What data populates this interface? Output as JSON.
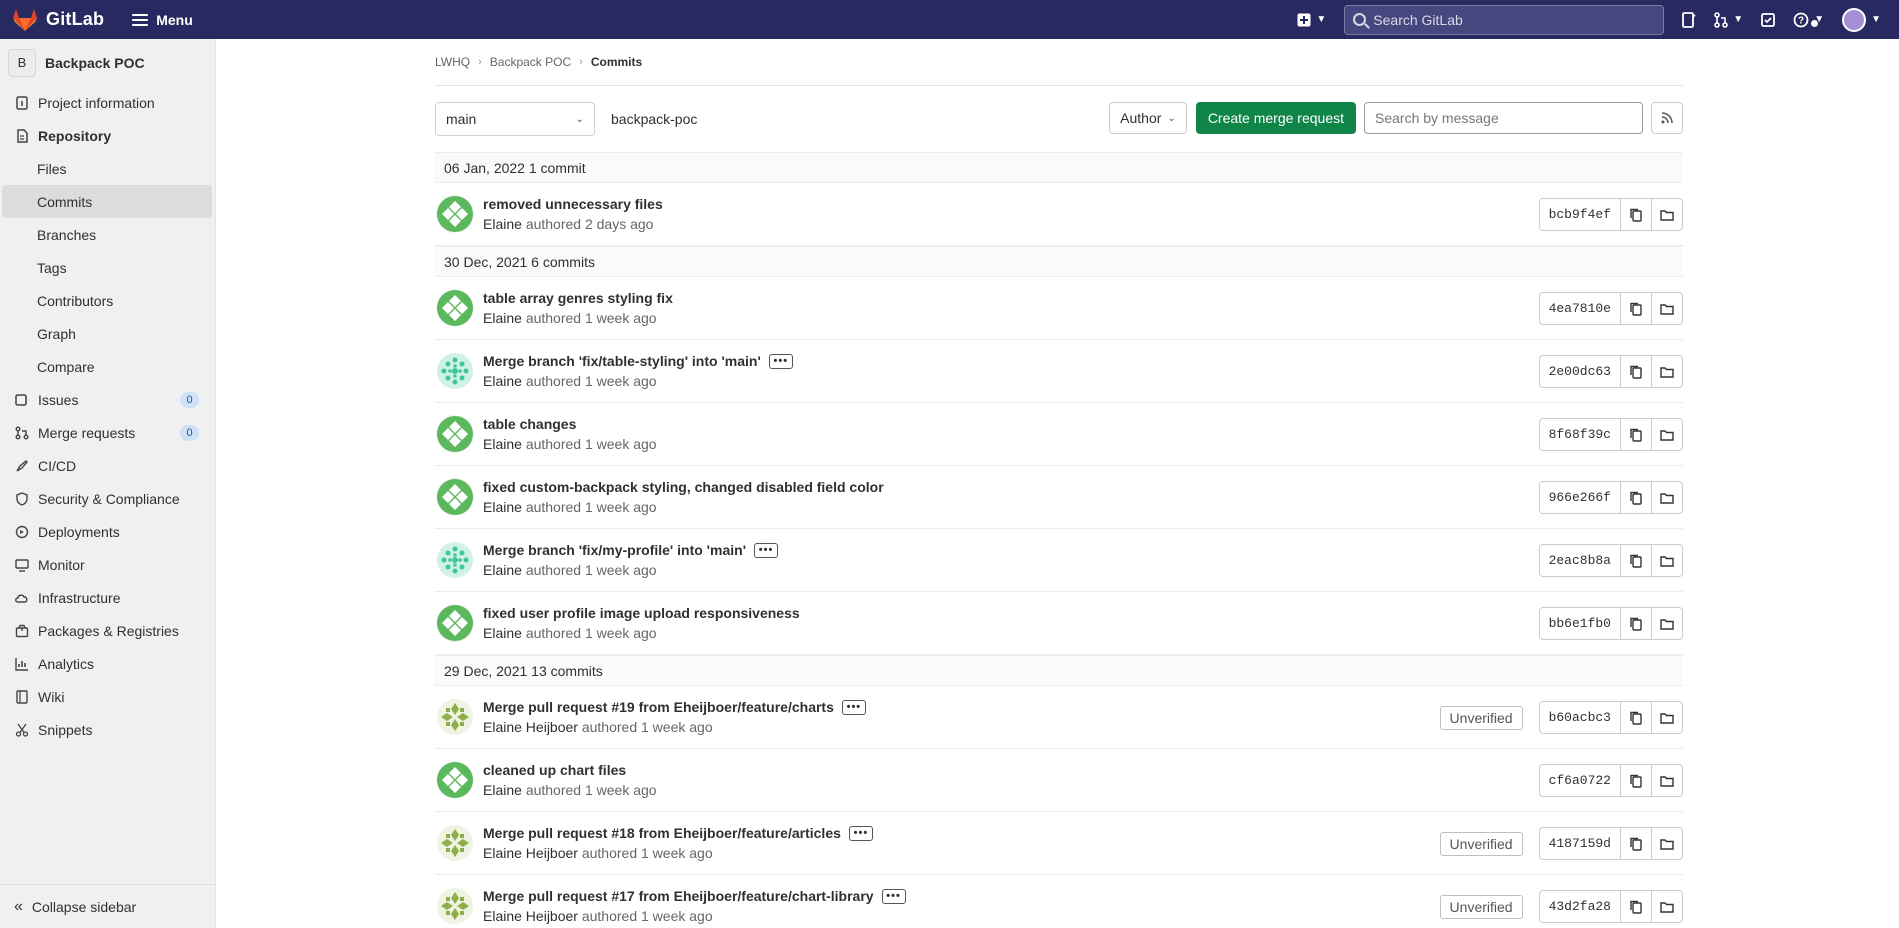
{
  "topbar": {
    "logo_text": "GitLab",
    "menu_label": "Menu",
    "search_placeholder": "Search GitLab",
    "brand_color": "#292961"
  },
  "sidebar": {
    "project_initial": "B",
    "project_name": "Backpack POC",
    "items": [
      {
        "label": "Project information",
        "icon": "info-icon"
      },
      {
        "label": "Repository",
        "icon": "repository-icon"
      },
      {
        "label": "Files"
      },
      {
        "label": "Commits"
      },
      {
        "label": "Branches"
      },
      {
        "label": "Tags"
      },
      {
        "label": "Contributors"
      },
      {
        "label": "Graph"
      },
      {
        "label": "Compare"
      },
      {
        "label": "Issues",
        "icon": "issues-icon",
        "count": "0"
      },
      {
        "label": "Merge requests",
        "icon": "merge-request-icon",
        "count": "0"
      },
      {
        "label": "CI/CD",
        "icon": "rocket-icon"
      },
      {
        "label": "Security & Compliance",
        "icon": "shield-icon"
      },
      {
        "label": "Deployments",
        "icon": "deployments-icon"
      },
      {
        "label": "Monitor",
        "icon": "monitor-icon"
      },
      {
        "label": "Infrastructure",
        "icon": "cloud-icon"
      },
      {
        "label": "Packages & Registries",
        "icon": "package-icon"
      },
      {
        "label": "Analytics",
        "icon": "chart-icon"
      },
      {
        "label": "Wiki",
        "icon": "book-icon"
      },
      {
        "label": "Snippets",
        "icon": "scissors-icon"
      }
    ],
    "collapse_label": "Collapse sidebar"
  },
  "breadcrumb": {
    "group": "LWHQ",
    "project": "Backpack POC",
    "current": "Commits"
  },
  "toolbar": {
    "branch": "main",
    "repo_path": "backpack-poc",
    "author_label": "Author",
    "create_mr_label": "Create merge request",
    "search_placeholder": "Search by message"
  },
  "days": [
    {
      "header": "06 Jan, 2022 1 commit",
      "commits": [
        {
          "title": "removed unnecessary files",
          "author": "Elaine",
          "when": "authored 2 days ago",
          "sha": "bcb9f4ef",
          "more": false,
          "unverified": "",
          "avatar": "green"
        }
      ]
    },
    {
      "header": "30 Dec, 2021 6 commits",
      "commits": [
        {
          "title": "table array genres styling fix",
          "author": "Elaine",
          "when": "authored 1 week ago",
          "sha": "4ea7810e",
          "more": false,
          "unverified": "",
          "avatar": "green"
        },
        {
          "title": "Merge branch 'fix/table-styling' into 'main'",
          "author": "Elaine",
          "when": "authored 1 week ago",
          "sha": "2e00dc63",
          "more": true,
          "unverified": "",
          "avatar": "teal"
        },
        {
          "title": "table changes",
          "author": "Elaine",
          "when": "authored 1 week ago",
          "sha": "8f68f39c",
          "more": false,
          "unverified": "",
          "avatar": "green"
        },
        {
          "title": "fixed custom-backpack styling, changed disabled field color",
          "author": "Elaine",
          "when": "authored 1 week ago",
          "sha": "966e266f",
          "more": false,
          "unverified": "",
          "avatar": "green"
        },
        {
          "title": "Merge branch 'fix/my-profile' into 'main'",
          "author": "Elaine",
          "when": "authored 1 week ago",
          "sha": "2eac8b8a",
          "more": true,
          "unverified": "",
          "avatar": "teal"
        },
        {
          "title": "fixed user profile image upload responsiveness",
          "author": "Elaine",
          "when": "authored 1 week ago",
          "sha": "bb6e1fb0",
          "more": false,
          "unverified": "",
          "avatar": "green"
        }
      ]
    },
    {
      "header": "29 Dec, 2021 13 commits",
      "commits": [
        {
          "title": "Merge pull request #19 from Eheijboer/feature/charts",
          "author": "Elaine Heijboer",
          "when": "authored 1 week ago",
          "sha": "b60acbc3",
          "more": true,
          "unverified": "Unverified",
          "avatar": "olive"
        },
        {
          "title": "cleaned up chart files",
          "author": "Elaine",
          "when": "authored 1 week ago",
          "sha": "cf6a0722",
          "more": false,
          "unverified": "",
          "avatar": "green"
        },
        {
          "title": "Merge pull request #18 from Eheijboer/feature/articles",
          "author": "Elaine Heijboer",
          "when": "authored 1 week ago",
          "sha": "4187159d",
          "more": true,
          "unverified": "Unverified",
          "avatar": "olive"
        },
        {
          "title": "Merge pull request #17 from Eheijboer/feature/chart-library",
          "author": "Elaine Heijboer",
          "when": "authored 1 week ago",
          "sha": "43d2fa28",
          "more": true,
          "unverified": "Unverified",
          "avatar": "olive"
        }
      ]
    }
  ]
}
